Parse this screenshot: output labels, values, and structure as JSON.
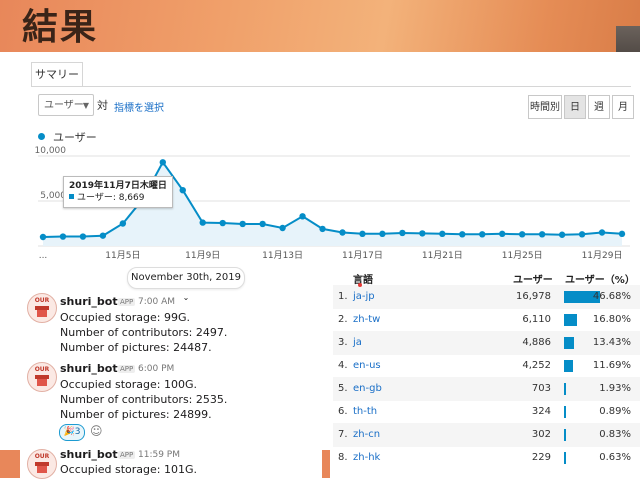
{
  "banner": {
    "title": "結果"
  },
  "ga": {
    "tab": "サマリー",
    "metric_selector": "ユーザー",
    "vs_label": "対",
    "choose_metric": "指標を選択",
    "periods": [
      "時間別",
      "日",
      "週",
      "月"
    ],
    "active_period": "日",
    "legend": "ユーザー",
    "series_color": "#058dc7"
  },
  "chart_data": {
    "type": "line",
    "series": [
      {
        "name": "ユーザー",
        "values": [
          1000,
          1050,
          1050,
          1150,
          2500,
          5200,
          9300,
          6200,
          2600,
          2550,
          2450,
          2450,
          2000,
          3300,
          1900,
          1500,
          1350,
          1350,
          1450,
          1400,
          1350,
          1300,
          1300,
          1350,
          1300,
          1300,
          1250,
          1300,
          1500,
          1350
        ]
      }
    ],
    "x": [
      "11月1日",
      "11月2日",
      "11月3日",
      "11月4日",
      "11月5日",
      "11月6日",
      "11月7日",
      "11月8日",
      "11月9日",
      "11月10日",
      "11月11日",
      "11月12日",
      "11月13日",
      "11月14日",
      "11月15日",
      "11月16日",
      "11月17日",
      "11月18日",
      "11月19日",
      "11月20日",
      "11月21日",
      "11月22日",
      "11月23日",
      "11月24日",
      "11月25日",
      "11月26日",
      "11月27日",
      "11月28日",
      "11月29日",
      "11月30日"
    ],
    "x_ticks": [
      "...",
      "11月5日",
      "11月9日",
      "11月13日",
      "11月17日",
      "11月21日",
      "11月25日",
      "11月29日"
    ],
    "y_ticks": [
      "5,000",
      "10,000"
    ],
    "ylim": [
      0,
      10000
    ],
    "tooltip": {
      "date": "2019年11月7日木曜日",
      "label": "ユーザー: 8,669",
      "value": 8669
    }
  },
  "slack": {
    "date_divider": "November 30th, 2019",
    "messages": [
      {
        "user": "shuri_bot",
        "app": "APP",
        "time": "7:00 AM",
        "lines": [
          "Occupied storage: 99G.",
          "Number of contributors: 2497.",
          "Number of pictures: 24487."
        ]
      },
      {
        "user": "shuri_bot",
        "app": "APP",
        "time": "6:00 PM",
        "lines": [
          "Occupied storage: 100G.",
          "Number of contributors: 2535.",
          "Number of pictures: 24899."
        ]
      },
      {
        "user": "shuri_bot",
        "app": "APP",
        "time": "11:59 PM",
        "lines": [
          "Occupied storage: 101G."
        ]
      }
    ],
    "reaction_count": "3",
    "avatar_text": "OUR"
  },
  "table": {
    "headers": {
      "language": "言語",
      "users": "ユーザー",
      "users_pct": "ユーザー（%）"
    },
    "rows": [
      {
        "rank": "1.",
        "lang": "ja-jp",
        "users": "16,978",
        "pct": "46.68%",
        "share": 46.68
      },
      {
        "rank": "2.",
        "lang": "zh-tw",
        "users": "6,110",
        "pct": "16.80%",
        "share": 16.8
      },
      {
        "rank": "3.",
        "lang": "ja",
        "users": "4,886",
        "pct": "13.43%",
        "share": 13.43
      },
      {
        "rank": "4.",
        "lang": "en-us",
        "users": "4,252",
        "pct": "11.69%",
        "share": 11.69
      },
      {
        "rank": "5.",
        "lang": "en-gb",
        "users": "703",
        "pct": "1.93%",
        "share": 1.93
      },
      {
        "rank": "6.",
        "lang": "th-th",
        "users": "324",
        "pct": "0.89%",
        "share": 0.89
      },
      {
        "rank": "7.",
        "lang": "zh-cn",
        "users": "302",
        "pct": "0.83%",
        "share": 0.83
      },
      {
        "rank": "8.",
        "lang": "zh-hk",
        "users": "229",
        "pct": "0.63%",
        "share": 0.63
      }
    ]
  }
}
